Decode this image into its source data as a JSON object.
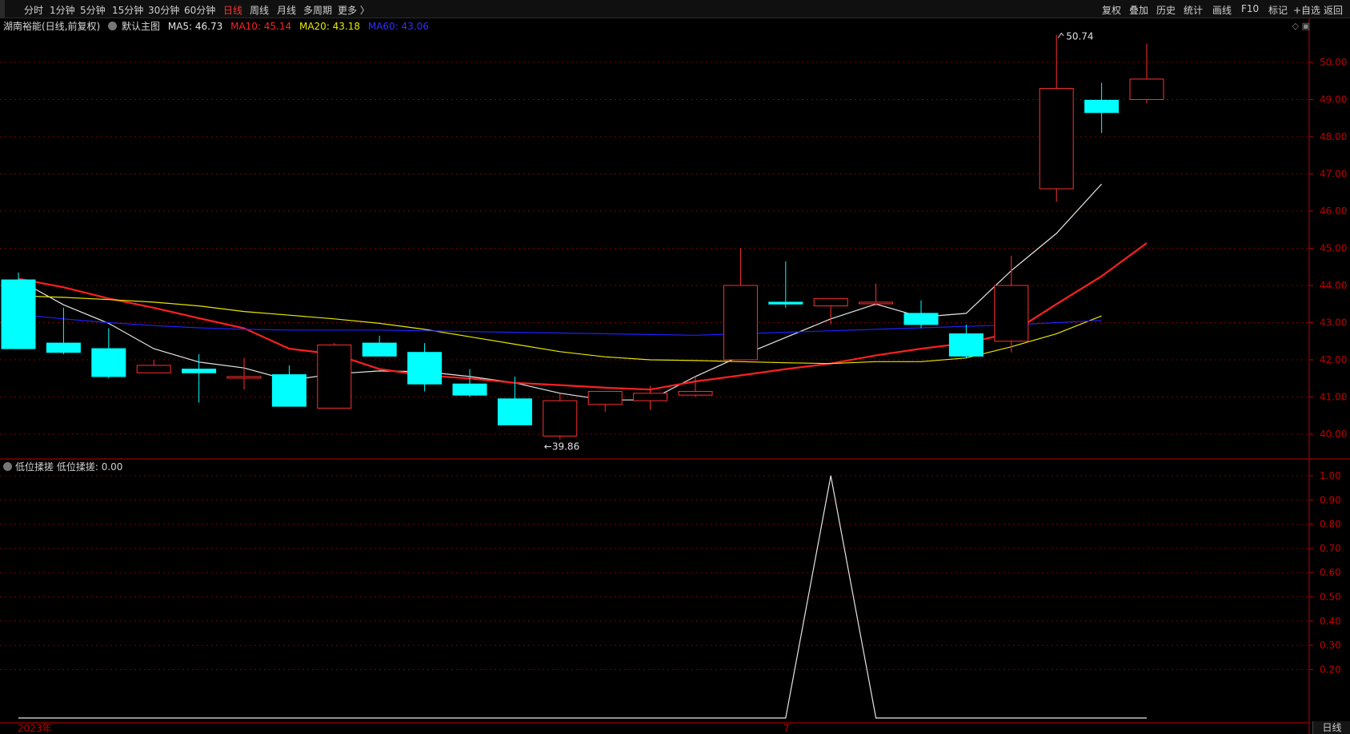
{
  "toolbar": {
    "left": [
      "分时",
      "1分钟",
      "5分钟",
      "15分钟",
      "30分钟",
      "60分钟",
      "日线",
      "周线",
      "月线",
      "多周期",
      "更多 〉"
    ],
    "active": "日线",
    "right": [
      "复权",
      "叠加",
      "历史",
      "统计",
      "画线",
      "F10",
      "标记",
      "+自选",
      "返回"
    ]
  },
  "legend": {
    "stock": "湖南裕能(日线,前复权)",
    "template": "默认主图",
    "ma5": "MA5: 46.73",
    "ma10": "MA10: 45.14",
    "ma20": "MA20: 43.18",
    "ma60": "MA60: 43.06"
  },
  "indicator": {
    "name": "低位揉搓",
    "value": "低位揉搓: 0.00"
  },
  "footer": {
    "year_label": "2023年",
    "month_label": "7",
    "tab": "日线"
  },
  "colors": {
    "up": "#ff3030",
    "down": "#00ffff",
    "ma5": "#e6e6e6",
    "ma10": "#ff2020",
    "ma20": "#e8e800",
    "ma60": "#2020ff",
    "grid": "#7a0000",
    "axis": "#c00000"
  },
  "chart_data": [
    {
      "type": "candlestick",
      "ylim": [
        39.6,
        51.5
      ],
      "yticks": [
        "50.00",
        "49.00",
        "48.00",
        "47.00",
        "46.00",
        "45.00",
        "44.00",
        "43.00",
        "42.00",
        "41.00",
        "40.00"
      ],
      "annotations": [
        {
          "label": "50.74",
          "index": 23,
          "price": 50.74
        },
        {
          "label": "39.86",
          "index": 12,
          "price": 39.86
        }
      ],
      "candles": [
        {
          "o": 44.15,
          "h": 44.35,
          "l": 42.3,
          "c": 42.3
        },
        {
          "o": 42.45,
          "h": 43.4,
          "l": 42.15,
          "c": 42.2
        },
        {
          "o": 42.3,
          "h": 42.85,
          "l": 41.5,
          "c": 41.55
        },
        {
          "o": 41.65,
          "h": 42.0,
          "l": 41.65,
          "c": 41.85
        },
        {
          "o": 41.75,
          "h": 42.15,
          "l": 40.85,
          "c": 41.65
        },
        {
          "o": 41.55,
          "h": 42.05,
          "l": 41.2,
          "c": 41.55
        },
        {
          "o": 41.6,
          "h": 41.85,
          "l": 40.75,
          "c": 40.75
        },
        {
          "o": 40.7,
          "h": 42.45,
          "l": 40.7,
          "c": 42.4
        },
        {
          "o": 42.45,
          "h": 42.65,
          "l": 42.1,
          "c": 42.1
        },
        {
          "o": 42.2,
          "h": 42.45,
          "l": 41.15,
          "c": 41.35
        },
        {
          "o": 41.35,
          "h": 41.75,
          "l": 41.0,
          "c": 41.05
        },
        {
          "o": 40.95,
          "h": 41.55,
          "l": 40.25,
          "c": 40.25
        },
        {
          "o": 39.95,
          "h": 41.1,
          "l": 39.86,
          "c": 40.9
        },
        {
          "o": 40.8,
          "h": 41.15,
          "l": 40.6,
          "c": 41.15
        },
        {
          "o": 40.9,
          "h": 41.3,
          "l": 40.65,
          "c": 41.1
        },
        {
          "o": 41.05,
          "h": 41.55,
          "l": 41.0,
          "c": 41.15
        },
        {
          "o": 42.0,
          "h": 45.0,
          "l": 42.0,
          "c": 44.0
        },
        {
          "o": 43.55,
          "h": 44.65,
          "l": 43.4,
          "c": 43.5
        },
        {
          "o": 43.45,
          "h": 43.65,
          "l": 42.95,
          "c": 43.65
        },
        {
          "o": 43.55,
          "h": 44.05,
          "l": 43.45,
          "c": 43.55
        },
        {
          "o": 43.25,
          "h": 43.6,
          "l": 42.85,
          "c": 42.95
        },
        {
          "o": 42.7,
          "h": 42.95,
          "l": 42.05,
          "c": 42.1
        },
        {
          "o": 42.5,
          "h": 44.8,
          "l": 42.2,
          "c": 44.0
        },
        {
          "o": 46.6,
          "h": 50.74,
          "l": 46.25,
          "c": 49.3
        },
        {
          "o": 48.98,
          "h": 49.45,
          "l": 48.1,
          "c": 48.65
        },
        {
          "o": 49.0,
          "h": 50.5,
          "l": 48.9,
          "c": 49.55
        }
      ],
      "series": [
        {
          "name": "MA5",
          "values": [
            44.15,
            43.48,
            42.98,
            42.3,
            41.94,
            41.78,
            41.45,
            41.62,
            41.7,
            41.68,
            41.55,
            41.38,
            41.1,
            40.92,
            40.92,
            41.55,
            42.1,
            42.6,
            43.1,
            43.5,
            43.15,
            43.25,
            44.4,
            45.4,
            46.73
          ]
        },
        {
          "name": "MA10",
          "values": [
            44.18,
            43.95,
            43.65,
            43.4,
            43.12,
            42.85,
            42.3,
            42.15,
            41.75,
            41.58,
            41.5,
            41.38,
            41.32,
            41.25,
            41.2,
            41.42,
            41.58,
            41.75,
            41.9,
            42.12,
            42.3,
            42.45,
            42.72,
            43.5,
            44.25,
            45.14
          ]
        },
        {
          "name": "MA20",
          "values": [
            43.72,
            43.68,
            43.62,
            43.55,
            43.45,
            43.3,
            43.2,
            43.1,
            42.98,
            42.82,
            42.62,
            42.42,
            42.22,
            42.08,
            42.0,
            41.98,
            41.95,
            41.92,
            41.9,
            41.95,
            41.95,
            42.05,
            42.35,
            42.7,
            43.18
          ]
        },
        {
          "name": "MA60",
          "values": [
            43.22,
            43.1,
            43.0,
            42.92,
            42.86,
            42.82,
            42.8,
            42.8,
            42.8,
            42.78,
            42.76,
            42.74,
            42.72,
            42.7,
            42.68,
            42.66,
            42.7,
            42.74,
            42.78,
            42.82,
            42.86,
            42.9,
            42.94,
            43.0,
            43.06
          ]
        }
      ]
    },
    {
      "type": "line",
      "ylim": [
        0,
        1.08
      ],
      "yticks": [
        "1.00",
        "0.90",
        "0.80",
        "0.70",
        "0.60",
        "0.50",
        "0.40",
        "0.30",
        "0.20"
      ],
      "series": [
        {
          "name": "低位揉搓",
          "values": [
            0,
            0,
            0,
            0,
            0,
            0,
            0,
            0,
            0,
            0,
            0,
            0,
            0,
            0,
            0,
            0,
            0,
            0,
            1,
            0,
            0,
            0,
            0,
            0,
            0,
            0
          ]
        }
      ]
    }
  ]
}
